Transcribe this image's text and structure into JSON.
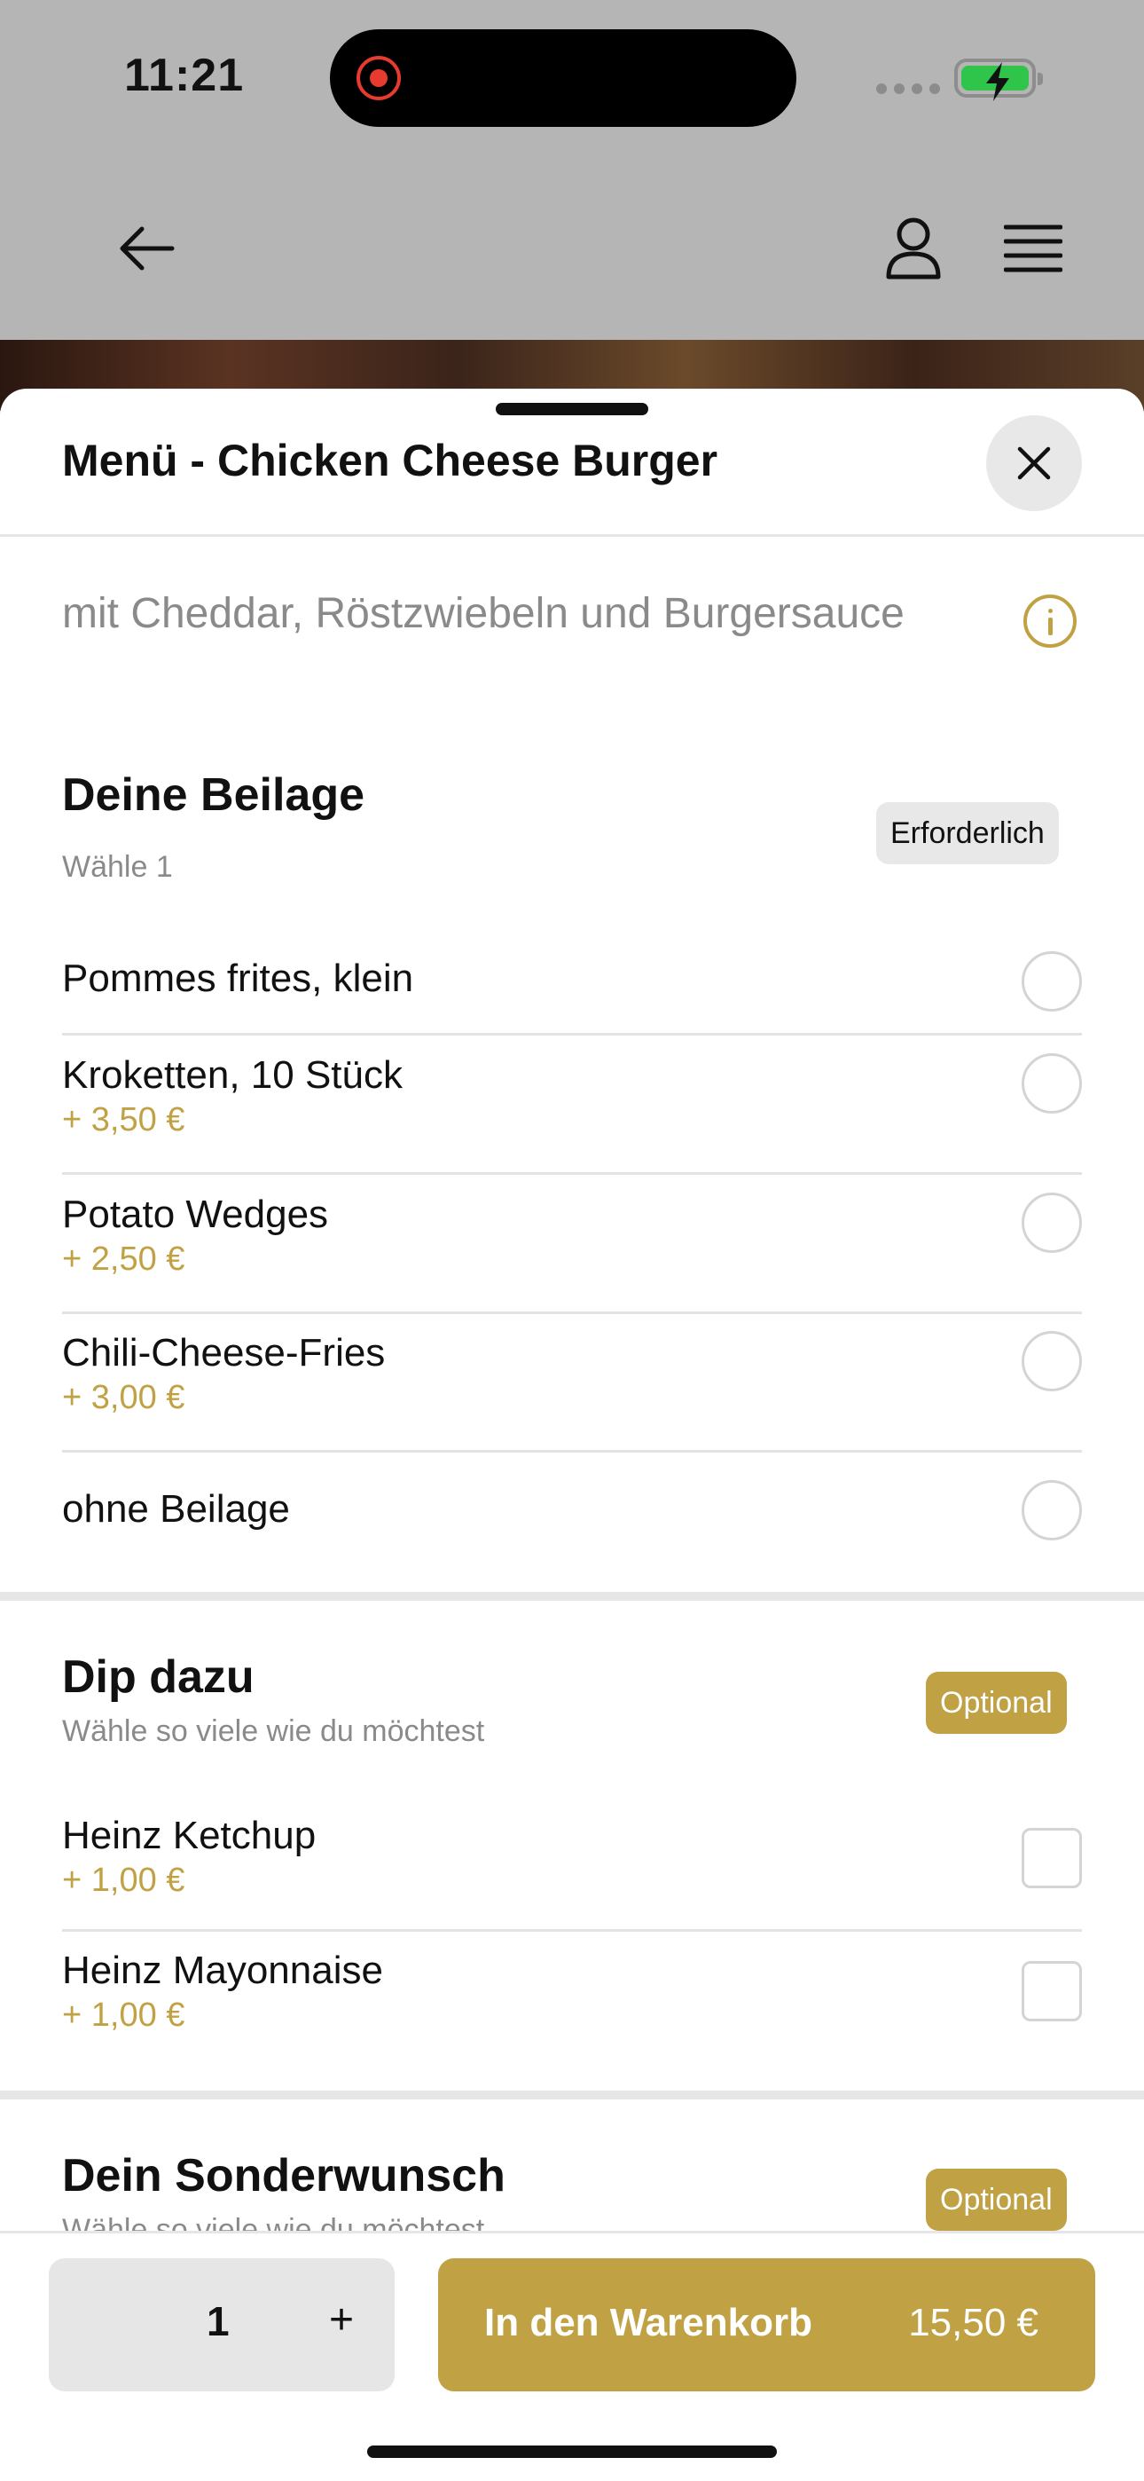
{
  "status_bar": {
    "time": "11:21"
  },
  "sheet": {
    "title": "Menü - Chicken Cheese Burger",
    "description": "mit Cheddar, Röstzwiebeln und Burgersauce"
  },
  "sections": [
    {
      "title": "Deine Beilage",
      "subtitle": "Wähle 1",
      "badge": "Erforderlich",
      "options": [
        {
          "name": "Pommes frites, klein",
          "price": ""
        },
        {
          "name": "Kroketten, 10 Stück",
          "price": "+ 3,50 €"
        },
        {
          "name": "Potato Wedges",
          "price": "+ 2,50 €"
        },
        {
          "name": "Chili-Cheese-Fries",
          "price": "+ 3,00 €"
        },
        {
          "name": "ohne Beilage",
          "price": ""
        }
      ]
    },
    {
      "title": "Dip dazu",
      "subtitle": "Wähle so viele wie du möchtest",
      "badge": "Optional",
      "options": [
        {
          "name": "Heinz Ketchup",
          "price": "+ 1,00 €"
        },
        {
          "name": "Heinz Mayonnaise",
          "price": "+ 1,00 €"
        }
      ]
    },
    {
      "title": "Dein Sonderwunsch",
      "subtitle": "Wähle so viele wie du möchtest",
      "badge": "Optional"
    }
  ],
  "bottom_bar": {
    "quantity": "1",
    "plus": "+",
    "cart_label": "In den Warenkorb",
    "cart_price": "15,50 €"
  },
  "colors": {
    "accent": "#c0a244",
    "background": "#b5b5b5"
  }
}
